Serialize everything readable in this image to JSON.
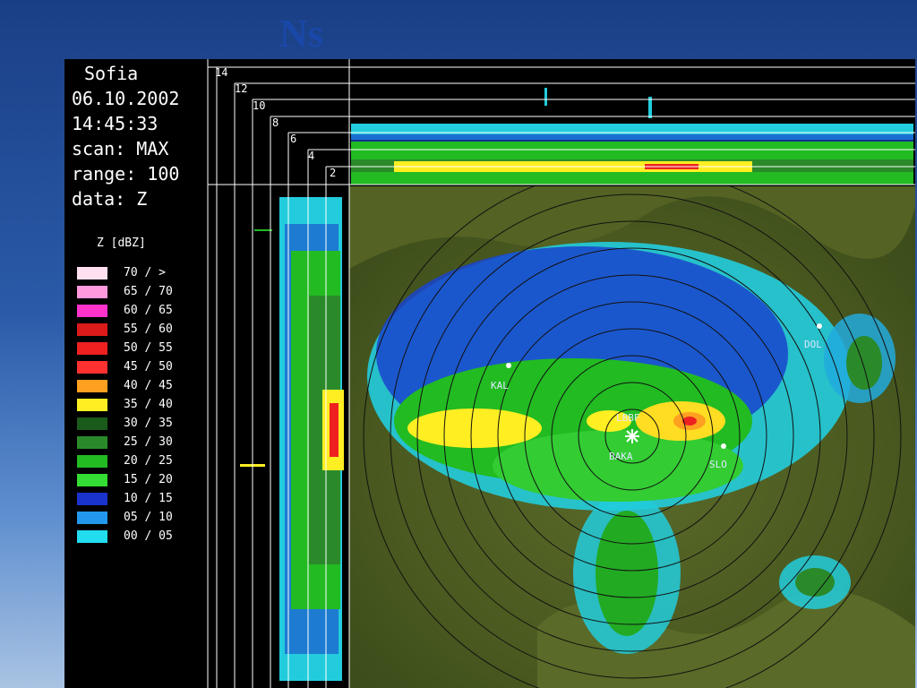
{
  "slide": {
    "title": "Ns"
  },
  "radar": {
    "site": "Sofia",
    "date": "06.10.2002",
    "time": "14:45:33",
    "scan": "scan: MAX",
    "range": "range: 100",
    "data": "data: Z"
  },
  "legend": {
    "title": "Z [dBZ]",
    "items": [
      {
        "label": "70 / >",
        "color": "#ffe0f0"
      },
      {
        "label": "65 / 70",
        "color": "#ff99dd"
      },
      {
        "label": "60 / 65",
        "color": "#ff33cc"
      },
      {
        "label": "55 / 60",
        "color": "#dd1a1a"
      },
      {
        "label": "50 / 55",
        "color": "#ee2020"
      },
      {
        "label": "45 / 50",
        "color": "#ff3030"
      },
      {
        "label": "40 / 45",
        "color": "#ffa020"
      },
      {
        "label": "35 / 40",
        "color": "#ffee22"
      },
      {
        "label": "30 / 35",
        "color": "#1a5a1a"
      },
      {
        "label": "25 / 30",
        "color": "#2a8a2a"
      },
      {
        "label": "20 / 25",
        "color": "#22bb22"
      },
      {
        "label": "15 / 20",
        "color": "#33dd33"
      },
      {
        "label": "10 / 15",
        "color": "#1a33cc"
      },
      {
        "label": "05 / 10",
        "color": "#2299ee"
      },
      {
        "label": "00 / 05",
        "color": "#22ddee"
      }
    ]
  },
  "altitudes": [
    "14",
    "12",
    "10",
    "8",
    "6",
    "4",
    "2"
  ],
  "sites": [
    "KAL",
    "LBBF",
    "BAKA",
    "SLO",
    "DOL"
  ]
}
